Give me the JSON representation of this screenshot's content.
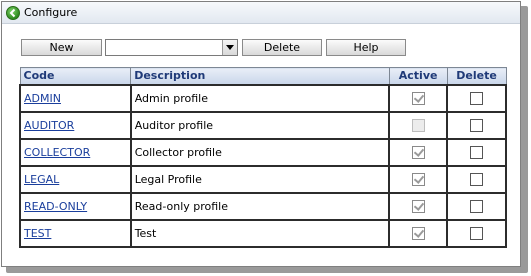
{
  "window": {
    "title": "Configure"
  },
  "toolbar": {
    "new_label": "New",
    "select_value": "",
    "delete_label": "Delete",
    "help_label": "Help"
  },
  "table": {
    "headers": {
      "code": "Code",
      "description": "Description",
      "active": "Active",
      "delete": "Delete"
    },
    "rows": [
      {
        "code": "ADMIN",
        "description": "Admin profile",
        "active": true,
        "active_enabled": false,
        "delete": false
      },
      {
        "code": "AUDITOR",
        "description": "Auditor profile",
        "active": false,
        "active_enabled": false,
        "delete": false
      },
      {
        "code": "COLLECTOR",
        "description": "Collector profile",
        "active": true,
        "active_enabled": false,
        "delete": false
      },
      {
        "code": "LEGAL",
        "description": "Legal Profile",
        "active": true,
        "active_enabled": false,
        "delete": false
      },
      {
        "code": "READ-ONLY",
        "description": "Read-only profile",
        "active": true,
        "active_enabled": false,
        "delete": false
      },
      {
        "code": "TEST",
        "description": "Test",
        "active": true,
        "active_enabled": false,
        "delete": false
      }
    ]
  },
  "icons": {
    "back": "back-arrow-icon",
    "dropdown": "chevron-down-icon"
  },
  "colors": {
    "link": "#1a3e9c",
    "header_text": "#1f3a78"
  }
}
